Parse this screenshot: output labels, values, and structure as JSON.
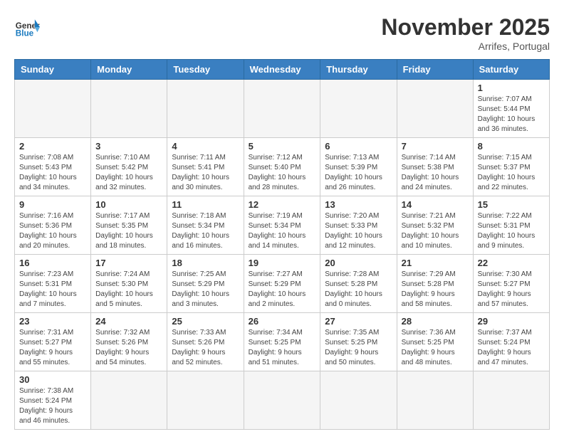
{
  "logo": {
    "text_general": "General",
    "text_blue": "Blue"
  },
  "title": "November 2025",
  "location": "Arrifes, Portugal",
  "weekdays": [
    "Sunday",
    "Monday",
    "Tuesday",
    "Wednesday",
    "Thursday",
    "Friday",
    "Saturday"
  ],
  "days": [
    {
      "day": "",
      "info": ""
    },
    {
      "day": "",
      "info": ""
    },
    {
      "day": "",
      "info": ""
    },
    {
      "day": "",
      "info": ""
    },
    {
      "day": "",
      "info": ""
    },
    {
      "day": "",
      "info": ""
    },
    {
      "day": "1",
      "info": "Sunrise: 7:07 AM\nSunset: 5:44 PM\nDaylight: 10 hours\nand 36 minutes."
    },
    {
      "day": "2",
      "info": "Sunrise: 7:08 AM\nSunset: 5:43 PM\nDaylight: 10 hours\nand 34 minutes."
    },
    {
      "day": "3",
      "info": "Sunrise: 7:10 AM\nSunset: 5:42 PM\nDaylight: 10 hours\nand 32 minutes."
    },
    {
      "day": "4",
      "info": "Sunrise: 7:11 AM\nSunset: 5:41 PM\nDaylight: 10 hours\nand 30 minutes."
    },
    {
      "day": "5",
      "info": "Sunrise: 7:12 AM\nSunset: 5:40 PM\nDaylight: 10 hours\nand 28 minutes."
    },
    {
      "day": "6",
      "info": "Sunrise: 7:13 AM\nSunset: 5:39 PM\nDaylight: 10 hours\nand 26 minutes."
    },
    {
      "day": "7",
      "info": "Sunrise: 7:14 AM\nSunset: 5:38 PM\nDaylight: 10 hours\nand 24 minutes."
    },
    {
      "day": "8",
      "info": "Sunrise: 7:15 AM\nSunset: 5:37 PM\nDaylight: 10 hours\nand 22 minutes."
    },
    {
      "day": "9",
      "info": "Sunrise: 7:16 AM\nSunset: 5:36 PM\nDaylight: 10 hours\nand 20 minutes."
    },
    {
      "day": "10",
      "info": "Sunrise: 7:17 AM\nSunset: 5:35 PM\nDaylight: 10 hours\nand 18 minutes."
    },
    {
      "day": "11",
      "info": "Sunrise: 7:18 AM\nSunset: 5:34 PM\nDaylight: 10 hours\nand 16 minutes."
    },
    {
      "day": "12",
      "info": "Sunrise: 7:19 AM\nSunset: 5:34 PM\nDaylight: 10 hours\nand 14 minutes."
    },
    {
      "day": "13",
      "info": "Sunrise: 7:20 AM\nSunset: 5:33 PM\nDaylight: 10 hours\nand 12 minutes."
    },
    {
      "day": "14",
      "info": "Sunrise: 7:21 AM\nSunset: 5:32 PM\nDaylight: 10 hours\nand 10 minutes."
    },
    {
      "day": "15",
      "info": "Sunrise: 7:22 AM\nSunset: 5:31 PM\nDaylight: 10 hours\nand 9 minutes."
    },
    {
      "day": "16",
      "info": "Sunrise: 7:23 AM\nSunset: 5:31 PM\nDaylight: 10 hours\nand 7 minutes."
    },
    {
      "day": "17",
      "info": "Sunrise: 7:24 AM\nSunset: 5:30 PM\nDaylight: 10 hours\nand 5 minutes."
    },
    {
      "day": "18",
      "info": "Sunrise: 7:25 AM\nSunset: 5:29 PM\nDaylight: 10 hours\nand 3 minutes."
    },
    {
      "day": "19",
      "info": "Sunrise: 7:27 AM\nSunset: 5:29 PM\nDaylight: 10 hours\nand 2 minutes."
    },
    {
      "day": "20",
      "info": "Sunrise: 7:28 AM\nSunset: 5:28 PM\nDaylight: 10 hours\nand 0 minutes."
    },
    {
      "day": "21",
      "info": "Sunrise: 7:29 AM\nSunset: 5:28 PM\nDaylight: 9 hours\nand 58 minutes."
    },
    {
      "day": "22",
      "info": "Sunrise: 7:30 AM\nSunset: 5:27 PM\nDaylight: 9 hours\nand 57 minutes."
    },
    {
      "day": "23",
      "info": "Sunrise: 7:31 AM\nSunset: 5:27 PM\nDaylight: 9 hours\nand 55 minutes."
    },
    {
      "day": "24",
      "info": "Sunrise: 7:32 AM\nSunset: 5:26 PM\nDaylight: 9 hours\nand 54 minutes."
    },
    {
      "day": "25",
      "info": "Sunrise: 7:33 AM\nSunset: 5:26 PM\nDaylight: 9 hours\nand 52 minutes."
    },
    {
      "day": "26",
      "info": "Sunrise: 7:34 AM\nSunset: 5:25 PM\nDaylight: 9 hours\nand 51 minutes."
    },
    {
      "day": "27",
      "info": "Sunrise: 7:35 AM\nSunset: 5:25 PM\nDaylight: 9 hours\nand 50 minutes."
    },
    {
      "day": "28",
      "info": "Sunrise: 7:36 AM\nSunset: 5:25 PM\nDaylight: 9 hours\nand 48 minutes."
    },
    {
      "day": "29",
      "info": "Sunrise: 7:37 AM\nSunset: 5:24 PM\nDaylight: 9 hours\nand 47 minutes."
    },
    {
      "day": "30",
      "info": "Sunrise: 7:38 AM\nSunset: 5:24 PM\nDaylight: 9 hours\nand 46 minutes."
    },
    {
      "day": "",
      "info": ""
    },
    {
      "day": "",
      "info": ""
    },
    {
      "day": "",
      "info": ""
    },
    {
      "day": "",
      "info": ""
    },
    {
      "day": "",
      "info": ""
    },
    {
      "day": "",
      "info": ""
    }
  ]
}
